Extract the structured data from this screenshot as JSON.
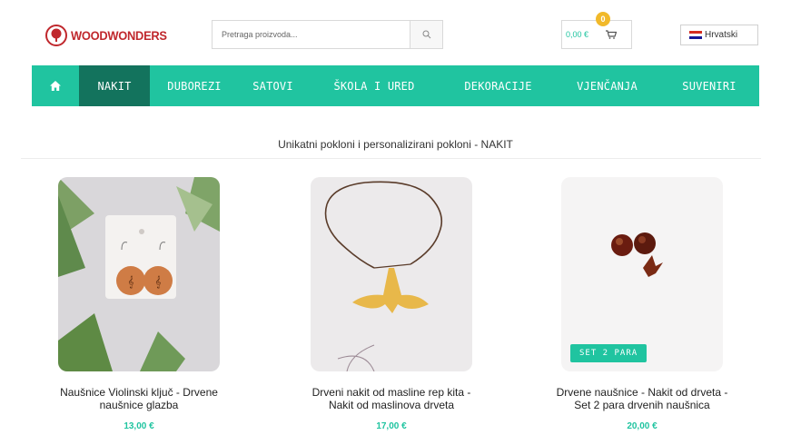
{
  "header": {
    "logo_text": "WOODWONDERS",
    "search_placeholder": "Pretraga proizvoda...",
    "cart_total": "0,00 €",
    "cart_count": "0",
    "language": "Hrvatski"
  },
  "nav": {
    "items": [
      {
        "label": "",
        "icon": "home-icon"
      },
      {
        "label": "NAKIT"
      },
      {
        "label": "DUBOREZI"
      },
      {
        "label": "SATOVI"
      },
      {
        "label": "ŠKOLA I URED"
      },
      {
        "label": "DEKORACIJE"
      },
      {
        "label": "VJENČANJA"
      },
      {
        "label": "SUVENIRI"
      }
    ],
    "active": "NAKIT"
  },
  "main": {
    "title": "Unikatni pokloni i personalizirani pokloni - NAKIT",
    "products": [
      {
        "name_line1": "Naušnice Violinski ključ - Drvene",
        "name_line2": "naušnice glazba",
        "price": "13,00 €",
        "badge": ""
      },
      {
        "name_line1": "Drveni nakit od masline rep kita -",
        "name_line2": "Nakit od maslinova drveta",
        "price": "17,00 €",
        "badge": ""
      },
      {
        "name_line1": "Drvene naušnice - Nakit od drveta -",
        "name_line2": "Set 2 para drvenih naušnica",
        "price": "20,00 €",
        "badge": "SET 2 PARA"
      }
    ]
  },
  "colors": {
    "accent": "#20c4a0",
    "nav_active": "#13735d",
    "brand": "#c0282d",
    "badge": "#f1b92a"
  }
}
